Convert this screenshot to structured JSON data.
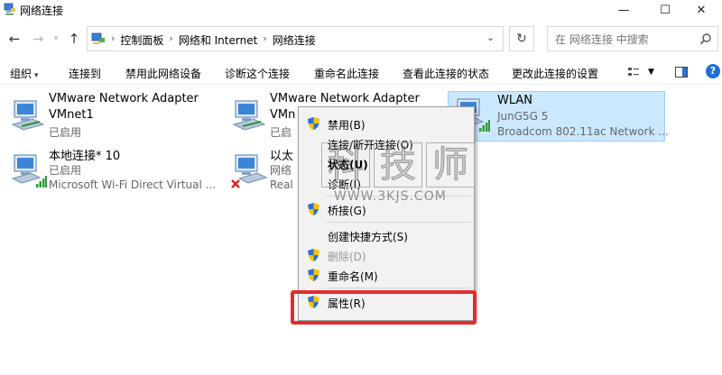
{
  "window": {
    "title": "网络连接"
  },
  "window_controls": {
    "minimize": "—",
    "maximize": "☐",
    "close": "✕"
  },
  "nav": {
    "back": "←",
    "forward": "→",
    "up": "↑"
  },
  "address": {
    "crumbs": [
      "控制面板",
      "网络和 Internet",
      "网络连接"
    ]
  },
  "search": {
    "placeholder": "在 网络连接 中搜索"
  },
  "toolbar": {
    "organize": "组织",
    "connect_to": "连接到",
    "disable_device": "禁用此网络设备",
    "diagnose": "诊断这个连接",
    "rename": "重命名此连接",
    "view_status": "查看此连接的状态",
    "change_settings": "更改此连接的设置",
    "help": "?"
  },
  "connections": [
    {
      "name": "VMware Network Adapter",
      "line2": "VMnet1",
      "line3": "已启用"
    },
    {
      "name": "VMware Network Adapter",
      "line2": "VMn",
      "line3": "已启"
    },
    {
      "name": "WLAN",
      "line2": "JunG5G 5",
      "line3": "Broadcom 802.11ac Network ..."
    },
    {
      "name": "本地连接* 10",
      "line2": "已启用",
      "line3": "Microsoft Wi-Fi Direct Virtual ..."
    },
    {
      "name": "以太",
      "line2": "网络",
      "line3": "Real"
    }
  ],
  "context_menu": {
    "disable": "禁用(B)",
    "connect": "连接/断开连接(O)",
    "status": "状态(U)",
    "diagnose": "诊断(I)",
    "bridge": "桥接(G)",
    "create_shortcut": "创建快捷方式(S)",
    "delete": "删除(D)",
    "rename": "重命名(M)",
    "properties": "属性(R)"
  },
  "watermark": {
    "chars": [
      "科",
      "技",
      "师"
    ],
    "url": "WWW.3KJS.COM"
  },
  "colors": {
    "selection": "#cce8ff",
    "highlight": "#e52b2b",
    "shield_blue": "#2f6fd1",
    "shield_yellow": "#f5c400"
  }
}
